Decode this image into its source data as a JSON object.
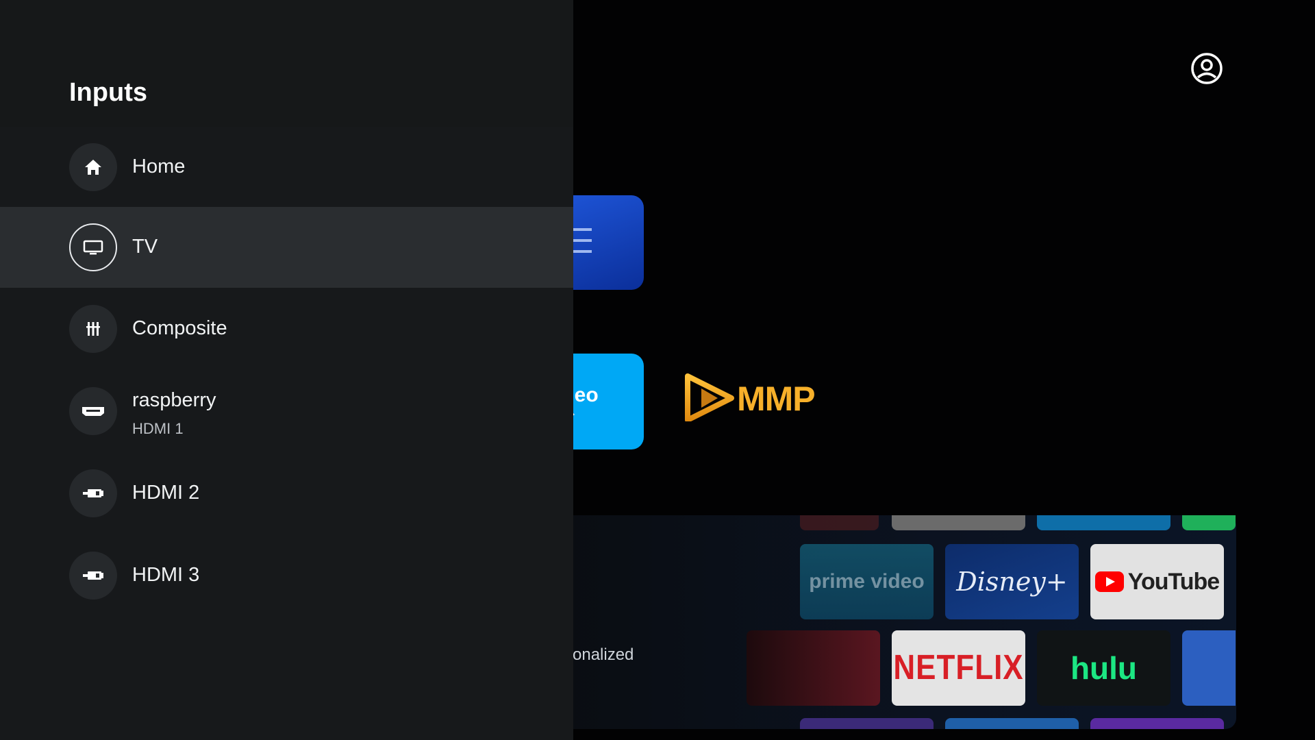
{
  "panel": {
    "title": "Inputs",
    "items": [
      {
        "label": "Home",
        "sublabel": "",
        "icon": "home-icon",
        "selected": false
      },
      {
        "label": "TV",
        "sublabel": "",
        "icon": "tv-icon",
        "selected": true
      },
      {
        "label": "Composite",
        "sublabel": "",
        "icon": "composite-icon",
        "selected": false
      },
      {
        "label": "raspberry",
        "sublabel": "HDMI 1",
        "icon": "hdmi-icon",
        "selected": false
      },
      {
        "label": "HDMI 2",
        "sublabel": "",
        "icon": "hdmi-icon",
        "selected": false
      },
      {
        "label": "HDMI 3",
        "sublabel": "",
        "icon": "hdmi-icon",
        "selected": false
      }
    ]
  },
  "background": {
    "account_icon": "account-circle-icon",
    "tiles": {
      "prime_partial_text": "ideo",
      "mmp_logo_text": "MMP"
    },
    "promo_text": "onalized",
    "apps": {
      "prime": "prime video",
      "disney": "Disney+",
      "youtube": "YouTube",
      "netflix": "NETFLIX",
      "hulu": "hulu"
    }
  },
  "colors": {
    "panel_bg": "#17191b",
    "selected_bg": "#2a2d30",
    "hulu_green": "#1ce783",
    "netflix_red": "#d81f26",
    "prime_blue": "#00a8f5"
  }
}
